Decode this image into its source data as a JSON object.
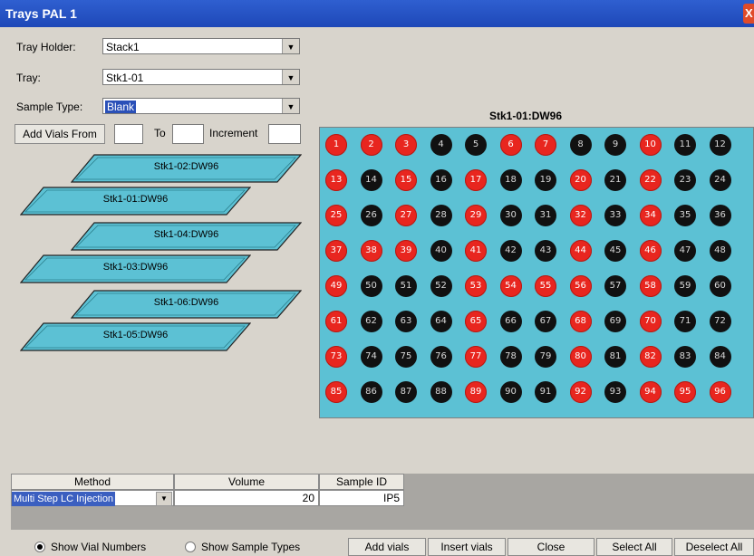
{
  "window": {
    "title": "Trays PAL 1",
    "close_glyph": "X"
  },
  "form": {
    "tray_holder_label": "Tray Holder:",
    "tray_holder_value": "Stack1",
    "tray_label": "Tray:",
    "tray_value": "Stk1-01",
    "sample_type_label": "Sample Type:",
    "sample_type_value": "Blank",
    "add_vials_from_label": "Add Vials From",
    "to_label": "To",
    "increment_label": "Increment",
    "from_value": "",
    "to_value": "",
    "increment_value": ""
  },
  "trays": [
    {
      "label": "Stk1-02:DW96"
    },
    {
      "label": "Stk1-01:DW96"
    },
    {
      "label": "Stk1-04:DW96"
    },
    {
      "label": "Stk1-03:DW96"
    },
    {
      "label": "Stk1-06:DW96"
    },
    {
      "label": "Stk1-05:DW96"
    }
  ],
  "plate": {
    "title": "Stk1-01:DW96",
    "colors": {
      "red": "#e8261f",
      "black": "#111111",
      "background": "#5cc1d4"
    },
    "red_vials": [
      1,
      2,
      3,
      6,
      7,
      10,
      13,
      15,
      17,
      20,
      22,
      25,
      27,
      29,
      32,
      34,
      37,
      38,
      39,
      41,
      44,
      46,
      49,
      53,
      54,
      55,
      56,
      58,
      61,
      65,
      68,
      70,
      73,
      77,
      80,
      82,
      85,
      89,
      92,
      94,
      95,
      96
    ]
  },
  "table": {
    "headers": [
      "Method",
      "Volume",
      "Sample ID"
    ],
    "row": {
      "method": "Multi Step LC Injection",
      "volume": "20",
      "sample_id": "IP5"
    }
  },
  "footer": {
    "show_vial_numbers": "Show Vial Numbers",
    "show_sample_types": "Show Sample Types",
    "add_vials": "Add vials",
    "insert_vials": "Insert vials",
    "close": "Close",
    "select_all": "Select All",
    "deselect_all": "Deselect All"
  }
}
